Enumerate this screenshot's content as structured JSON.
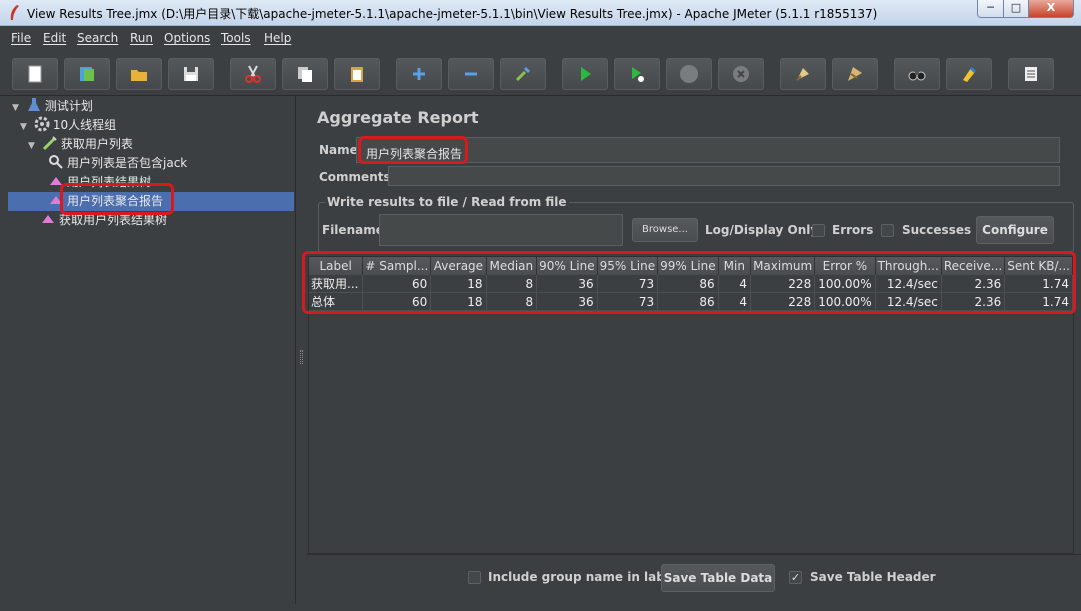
{
  "window": {
    "title": "View Results Tree.jmx (D:\\用户目录\\下载\\apache-jmeter-5.1.1\\apache-jmeter-5.1.1\\bin\\View Results Tree.jmx) - Apache JMeter (5.1.1 r1855137)",
    "min_label": "─",
    "max_label": "□",
    "close_label": "X"
  },
  "menu": [
    "File",
    "Edit",
    "Search",
    "Run",
    "Options",
    "Tools",
    "Help"
  ],
  "toolbar_icons": [
    "new-icon",
    "templates-icon",
    "open-icon",
    "save-icon",
    "cut-icon",
    "copy-icon",
    "paste-icon",
    "expand-icon",
    "collapse-icon",
    "toggle-icon",
    "start-icon",
    "start-no-pauses-icon",
    "stop-icon",
    "shutdown-icon",
    "clear-icon",
    "clear-all-icon",
    "search-icon",
    "reset-search-icon",
    "log-viewer-icon"
  ],
  "tree": {
    "items": [
      {
        "label": "测试计划",
        "icon": "test-plan-icon"
      },
      {
        "label": "10人线程组",
        "icon": "thread-group-icon"
      },
      {
        "label": "获取用户列表",
        "icon": "sampler-icon"
      },
      {
        "label": "用户列表是否包含jack",
        "icon": "assertion-icon"
      },
      {
        "label": "用户列表结果树",
        "icon": "listener-icon"
      },
      {
        "label": "用户列表聚合报告",
        "icon": "listener-icon"
      },
      {
        "label": "获取用户列表结果树",
        "icon": "listener-icon"
      }
    ]
  },
  "panel": {
    "title": "Aggregate Report",
    "name_label": "Name:",
    "name_value": "用户列表聚合报告",
    "comments_label": "Comments:",
    "file_group_title": "Write results to file / Read from file",
    "filename_label": "Filename",
    "filename_value": "",
    "browse_button": "Browse...",
    "log_display_label": "Log/Display Only:",
    "errors_label": "Errors",
    "successes_label": "Successes",
    "configure_button": "Configure"
  },
  "table": {
    "headers": [
      "Label",
      "# Sampl...",
      "Average",
      "Median",
      "90% Line",
      "95% Line",
      "99% Line",
      "Min",
      "Maximum",
      "Error %",
      "Through...",
      "Receive...",
      "Sent KB/..."
    ],
    "rows": [
      [
        "获取用...",
        "60",
        "18",
        "8",
        "36",
        "73",
        "86",
        "4",
        "228",
        "100.00%",
        "12.4/sec",
        "2.36",
        "1.74"
      ],
      [
        "总体",
        "60",
        "18",
        "8",
        "36",
        "73",
        "86",
        "4",
        "228",
        "100.00%",
        "12.4/sec",
        "2.36",
        "1.74"
      ]
    ]
  },
  "bottom": {
    "include_group_label": "Include group name in label?",
    "include_group_checked": false,
    "save_table_data": "Save Table Data",
    "save_table_header_label": "Save Table Header",
    "save_table_header_checked": true
  },
  "colors": {
    "background": "#3c3f41",
    "selection": "#4b6eaf",
    "highlight": "#d8191e"
  }
}
